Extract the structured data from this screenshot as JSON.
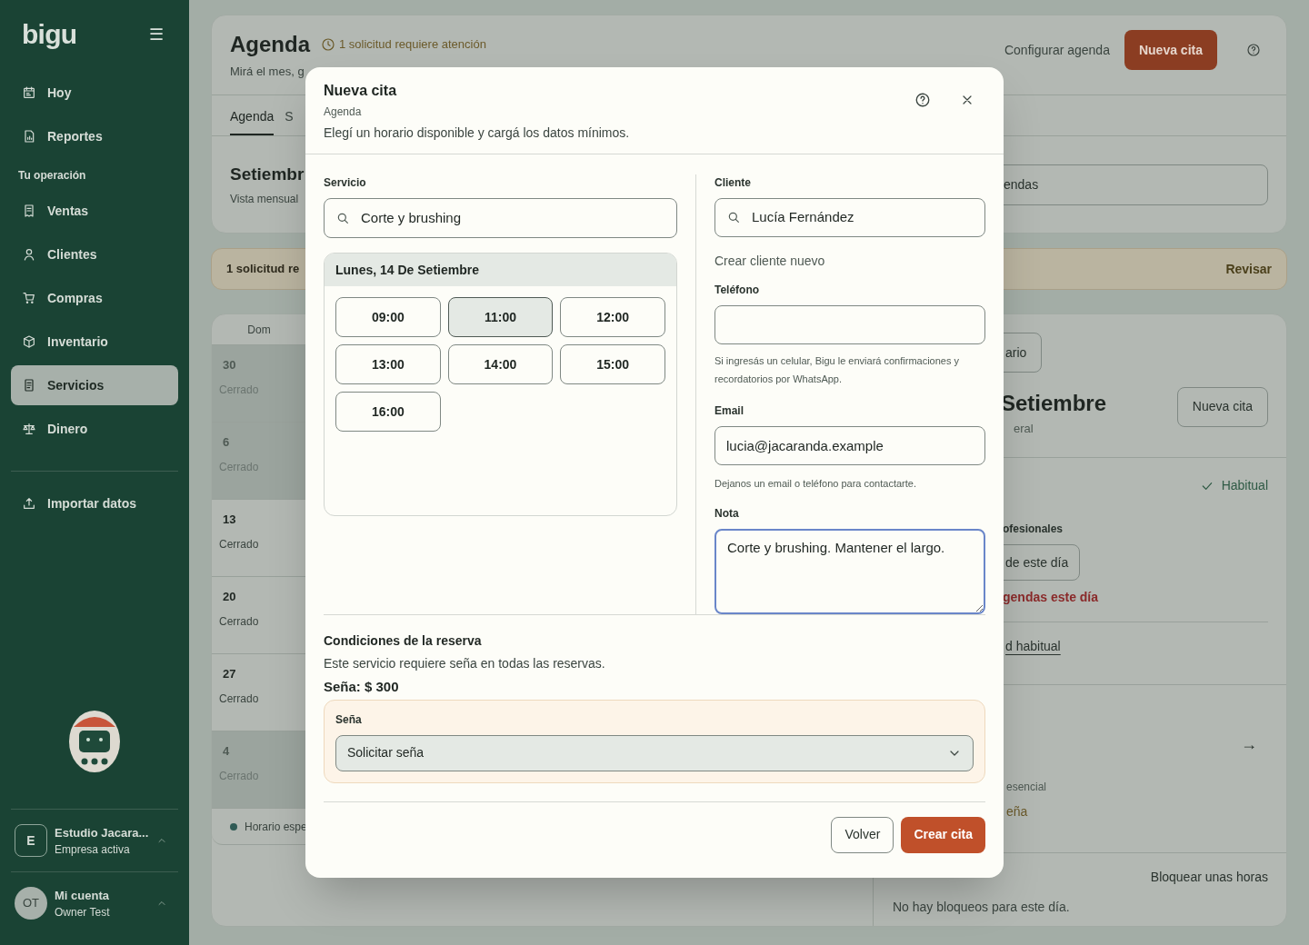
{
  "sidebar": {
    "logo": "bigu",
    "menu_icon": "☰",
    "items": [
      {
        "label": "Hoy",
        "selected": false
      },
      {
        "label": "Reportes",
        "selected": false
      }
    ],
    "section_label": "Tu operación",
    "section_items": [
      {
        "label": "Ventas",
        "selected": false
      },
      {
        "label": "Clientes",
        "selected": false
      },
      {
        "label": "Compras",
        "selected": false
      },
      {
        "label": "Inventario",
        "selected": false
      },
      {
        "label": "Servicios",
        "selected": true
      },
      {
        "label": "Dinero",
        "selected": false
      }
    ],
    "import": "Importar datos",
    "company": {
      "initial": "E",
      "name": "Estudio Jacara...",
      "status": "Empresa activa"
    },
    "account": {
      "initials": "OT",
      "name": "Mi cuenta",
      "user": "Owner Test"
    }
  },
  "header": {
    "title": "Agenda",
    "alert": "1 solicitud requiere atención",
    "subtitle": "Mirá el mes, g",
    "configure": "Configurar agenda",
    "new_button": "Nueva cita",
    "tabs": [
      {
        "label": "Agenda",
        "selected": true
      },
      {
        "label": "S",
        "selected": false
      }
    ],
    "month": "Setiembr",
    "view": "Vista mensual",
    "field_fragment": "endas"
  },
  "banner": {
    "text": "1 solicitud re",
    "action": "Revisar"
  },
  "calendar": {
    "column": "Dom",
    "days": [
      {
        "day": "30",
        "status": "Cerrado",
        "in_month": false
      },
      {
        "day": "6",
        "status": "Cerrado",
        "in_month": false
      },
      {
        "day": "13",
        "status": "Cerrado",
        "in_month": true
      },
      {
        "day": "20",
        "status": "Cerrado",
        "in_month": true
      },
      {
        "day": "27",
        "status": "Cerrado",
        "in_month": true
      },
      {
        "day": "4",
        "status": "Cerrado",
        "in_month": false
      }
    ],
    "legend": "Horario espe"
  },
  "day_panel": {
    "schedule_button": "ario",
    "title": "Setiembre",
    "subtitle": "eral",
    "new_button": "Nueva cita",
    "habitual": "Habitual",
    "professionals_label": "ofesionales",
    "day_button": "de este día",
    "warning": "gendas este día",
    "habitual_link": "d habitual",
    "arrow": "→",
    "essential": "esencial",
    "deposit": "eña",
    "block_button": "Bloquear unas horas",
    "no_blocks": "No hay bloqueos para este día."
  },
  "modal": {
    "title": "Nueva cita",
    "breadcrumb": "Agenda",
    "description": "Elegí un horario disponible y cargá los datos mínimos.",
    "service": {
      "label": "Servicio",
      "value": "Corte y brushing"
    },
    "date": "Lunes, 14 De Setiembre",
    "slots": [
      {
        "time": "09:00",
        "selected": false
      },
      {
        "time": "11:00",
        "selected": true
      },
      {
        "time": "12:00",
        "selected": false
      },
      {
        "time": "13:00",
        "selected": false
      },
      {
        "time": "14:00",
        "selected": false
      },
      {
        "time": "15:00",
        "selected": false
      },
      {
        "time": "16:00",
        "selected": false
      }
    ],
    "client": {
      "label": "Cliente",
      "value": "Lucía Fernández"
    },
    "new_client": "Crear cliente nuevo",
    "phone": {
      "label": "Teléfono",
      "hint": "Si ingresás un celular, Bigu le enviará confirmaciones y recordatorios por WhatsApp."
    },
    "email": {
      "label": "Email",
      "value": "lucia@jacaranda.example",
      "hint": "Dejanos un email o teléfono para contactarte."
    },
    "note": {
      "label": "Nota",
      "value": "Corte y brushing. Mantener el largo."
    },
    "conditions": {
      "title": "Condiciones de la reserva",
      "text": "Este servicio requiere seña en todas las reservas.",
      "amount": "Seña: $ 300",
      "select_label": "Seña",
      "select_value": "Solicitar seña"
    },
    "back": "Volver",
    "submit": "Crear cita"
  }
}
